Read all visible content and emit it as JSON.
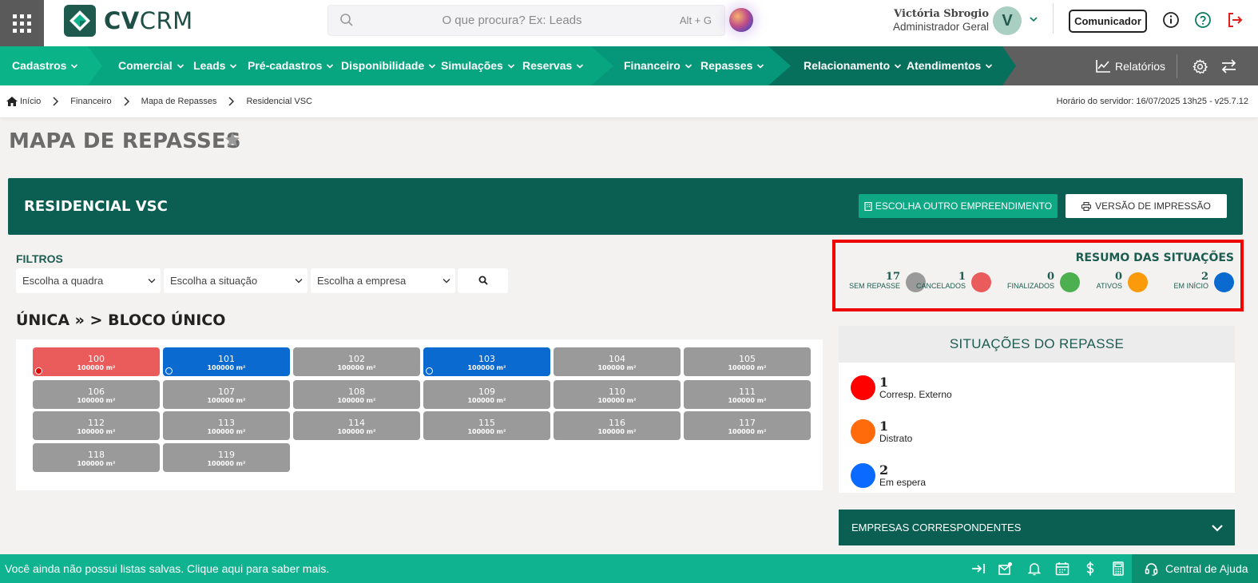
{
  "header": {
    "logo_text_bold": "CV",
    "logo_text_light": "CRM",
    "search_placeholder": "O que procura? Ex: Leads",
    "search_shortcut": "Alt + G",
    "user_name": "Victória Sbrogio",
    "user_role": "Administrador Geral",
    "avatar_initial": "V",
    "comunicador_label": "Comunicador"
  },
  "nav": {
    "items": [
      {
        "label": "Cadastros"
      },
      {
        "label": "Comercial"
      },
      {
        "label": "Leads"
      },
      {
        "label": "Pré-cadastros"
      },
      {
        "label": "Disponibilidade"
      },
      {
        "label": "Simulações"
      },
      {
        "label": "Reservas"
      },
      {
        "label": "Financeiro"
      },
      {
        "label": "Repasses"
      },
      {
        "label": "Relacionamento"
      },
      {
        "label": "Atendimentos"
      }
    ],
    "reports_label": "Relatórios",
    "colors": {
      "mint": "#0ab388",
      "teal": "#06977a",
      "dark": "#07705d",
      "gray": "#5f5f5f"
    }
  },
  "breadcrumb": {
    "items": [
      "Início",
      "Financeiro",
      "Mapa de Repasses",
      "Residencial VSC"
    ],
    "server_time": "Horário do servidor: 16/07/2025 13h25 - v25.7.12"
  },
  "page": {
    "title": "MAPA DE REPASSES",
    "project_name": "RESIDENCIAL VSC",
    "btn_choose": "ESCOLHA OUTRO EMPREENDIMENTO",
    "btn_print": "VERSÃO DE IMPRESSÃO"
  },
  "filters": {
    "title": "FILTROS",
    "quadra": "Escolha a quadra",
    "situacao": "Escolha a situação",
    "empresa": "Escolha a empresa"
  },
  "block": {
    "title": "ÚNICA » > BLOCO ÚNICO",
    "units": [
      {
        "number": "100",
        "area": "100000 m²",
        "color": "#ea5c5c",
        "dot": "#e00000"
      },
      {
        "number": "101",
        "area": "100000 m²",
        "color": "#0a6ad0",
        "dot": "#0a6ad0"
      },
      {
        "number": "102",
        "area": "100000 m²",
        "color": "#9a9a9a",
        "dot": ""
      },
      {
        "number": "103",
        "area": "100000 m²",
        "color": "#0a6ad0",
        "dot": "#0a6ad0"
      },
      {
        "number": "104",
        "area": "100000 m²",
        "color": "#9a9a9a",
        "dot": ""
      },
      {
        "number": "105",
        "area": "100000 m²",
        "color": "#9a9a9a",
        "dot": ""
      },
      {
        "number": "106",
        "area": "100000 m²",
        "color": "#9a9a9a",
        "dot": ""
      },
      {
        "number": "107",
        "area": "100000 m²",
        "color": "#9a9a9a",
        "dot": ""
      },
      {
        "number": "108",
        "area": "100000 m²",
        "color": "#9a9a9a",
        "dot": ""
      },
      {
        "number": "109",
        "area": "100000 m²",
        "color": "#9a9a9a",
        "dot": ""
      },
      {
        "number": "110",
        "area": "100000 m²",
        "color": "#9a9a9a",
        "dot": ""
      },
      {
        "number": "111",
        "area": "100000 m²",
        "color": "#9a9a9a",
        "dot": ""
      },
      {
        "number": "112",
        "area": "100000 m²",
        "color": "#9a9a9a",
        "dot": ""
      },
      {
        "number": "113",
        "area": "100000 m²",
        "color": "#9a9a9a",
        "dot": ""
      },
      {
        "number": "114",
        "area": "100000 m²",
        "color": "#9a9a9a",
        "dot": ""
      },
      {
        "number": "115",
        "area": "100000 m²",
        "color": "#9a9a9a",
        "dot": ""
      },
      {
        "number": "116",
        "area": "100000 m²",
        "color": "#9a9a9a",
        "dot": ""
      },
      {
        "number": "117",
        "area": "100000 m²",
        "color": "#9a9a9a",
        "dot": ""
      },
      {
        "number": "118",
        "area": "100000 m²",
        "color": "#9a9a9a",
        "dot": ""
      },
      {
        "number": "119",
        "area": "100000 m²",
        "color": "#9a9a9a",
        "dot": ""
      }
    ]
  },
  "summary": {
    "title": "RESUMO DAS SITUAÇÕES",
    "stats": [
      {
        "count": "17",
        "label": "SEM REPASSE",
        "color": "#9a9a9a"
      },
      {
        "count": "1",
        "label": "CANCELADOS",
        "color": "#ea5c5c"
      },
      {
        "count": "0",
        "label": "FINALIZADOS",
        "color": "#4caf50"
      },
      {
        "count": "0",
        "label": "ATIVOS",
        "color": "#fb9a0a"
      },
      {
        "count": "2",
        "label": "EM INÍCIO",
        "color": "#0a6ad0"
      }
    ]
  },
  "situations": {
    "title": "SITUAÇÕES DO REPASSE",
    "rows": [
      {
        "count": "1",
        "label": "Corresp. Externo",
        "color": "#ff0000"
      },
      {
        "count": "1",
        "label": "Distrato",
        "color": "#ff6a0a"
      },
      {
        "count": "2",
        "label": "Em espera",
        "color": "#0a6aff"
      }
    ]
  },
  "empresas_label": "EMPRESAS CORRESPONDENTES",
  "footer": {
    "message": "Você ainda não possui listas salvas. Clique aqui para saber mais.",
    "help_label": "Central de Ajuda"
  }
}
